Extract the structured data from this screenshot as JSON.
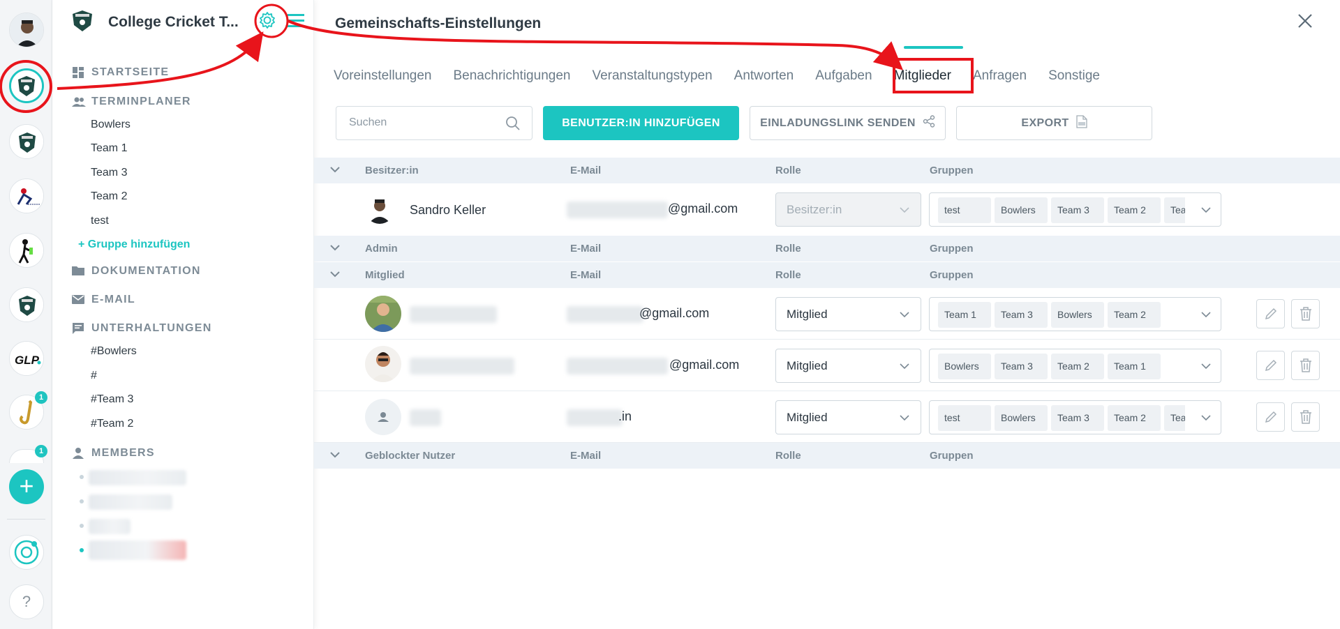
{
  "sidebar": {
    "community_title": "College Cricket T...",
    "sections": {
      "home": "STARTSEITE",
      "scheduler": "TERMINPLANER",
      "docs": "DOKUMENTATION",
      "email": "E-MAIL",
      "conversations": "UNTERHALTUNGEN",
      "members": "MEMBERS"
    },
    "scheduler_items": [
      "Bowlers",
      "Team 1",
      "Team 3",
      "Team 2",
      "test"
    ],
    "add_group": "+ Gruppe hinzufügen",
    "conversation_items": [
      "#Bowlers",
      "#",
      "#Team 3",
      "#Team 2"
    ]
  },
  "rail": {
    "badges": [
      "1",
      "1"
    ],
    "add_icon": "plus-icon",
    "help": "?"
  },
  "main": {
    "title": "Gemeinschafts-Einstellungen",
    "tabs": [
      "Voreinstellungen",
      "Benachrichtigungen",
      "Veranstaltungstypen",
      "Antworten",
      "Aufgaben",
      "Mitglieder",
      "Anfragen",
      "Sonstige"
    ],
    "active_tab": "Mitglieder",
    "search_placeholder": "Suchen",
    "btn_add_user": "BENUTZER:IN HINZUFÜGEN",
    "btn_invite": "EINLADUNGSLINK SENDEN",
    "btn_export": "EXPORT"
  },
  "columns": {
    "email": "E-Mail",
    "role": "Rolle",
    "groups": "Gruppen"
  },
  "groups": {
    "owner": "Besitzer:in",
    "admin": "Admin",
    "member": "Mitglied",
    "blocked": "Geblockter Nutzer"
  },
  "owner_row": {
    "name": "Sandro Keller",
    "email_suffix": "@gmail.com",
    "role": "Besitzer:in",
    "groups": [
      "test",
      "Bowlers",
      "Team 3",
      "Team 2",
      "Team"
    ]
  },
  "member_rows": [
    {
      "email_suffix": "@gmail.com",
      "role": "Mitglied",
      "groups": [
        "Team 1",
        "Team 3",
        "Bowlers",
        "Team 2"
      ]
    },
    {
      "email_suffix": "@gmail.com",
      "role": "Mitglied",
      "groups": [
        "Bowlers",
        "Team 3",
        "Team 2",
        "Team 1"
      ]
    },
    {
      "email_suffix": ".in",
      "role": "Mitglied",
      "groups": [
        "test",
        "Bowlers",
        "Team 3",
        "Team 2",
        "Team"
      ]
    }
  ],
  "colors": {
    "accent": "#1cc5c1",
    "annotation": "#e8141b",
    "group_header_bg": "#edf2f7"
  }
}
